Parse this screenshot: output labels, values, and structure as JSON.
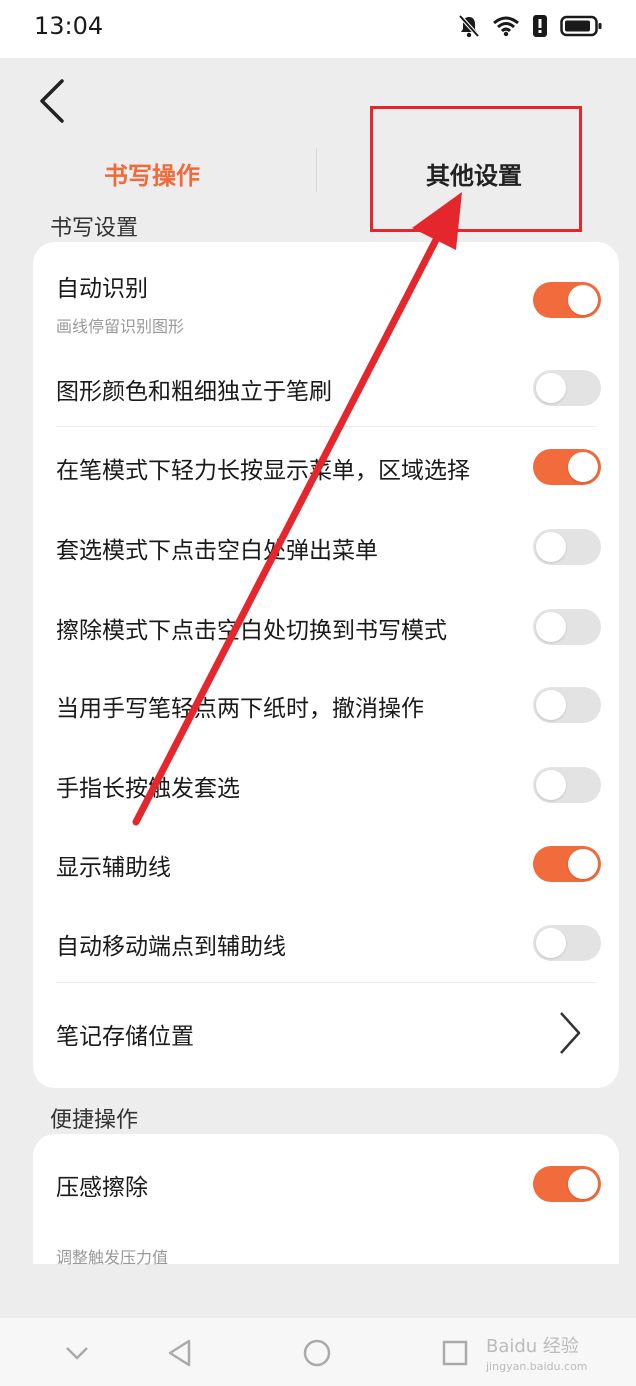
{
  "status_bar": {
    "time": "13:04",
    "icons": [
      "bell-mute-icon",
      "wifi-icon",
      "alert-icon",
      "battery-icon"
    ]
  },
  "header": {
    "back_icon": "back-chevron-icon",
    "tabs": [
      {
        "label": "书写操作",
        "active": true
      },
      {
        "label": "其他设置",
        "active": false
      }
    ]
  },
  "writing_settings": {
    "title": "书写设置",
    "items": [
      {
        "label": "自动识别",
        "sublabel": "画线停留识别图形",
        "control": "toggle",
        "on": true
      },
      {
        "label": "图形颜色和粗细独立于笔刷",
        "control": "toggle",
        "on": false
      },
      {
        "label": "在笔模式下轻力长按显示菜单，区域选择",
        "control": "toggle",
        "on": true
      },
      {
        "label": "套选模式下点击空白处弹出菜单",
        "control": "toggle",
        "on": false
      },
      {
        "label": "擦除模式下点击空白处切换到书写模式",
        "control": "toggle",
        "on": false
      },
      {
        "label": "当用手写笔轻点两下纸时，撤消操作",
        "control": "toggle",
        "on": false
      },
      {
        "label": "手指长按触发套选",
        "control": "toggle",
        "on": false
      },
      {
        "label": "显示辅助线",
        "control": "toggle",
        "on": true
      },
      {
        "label": "自动移动端点到辅助线",
        "control": "toggle",
        "on": false
      },
      {
        "label": "笔记存储位置",
        "control": "chevron"
      }
    ]
  },
  "quick_actions": {
    "title": "便捷操作",
    "items": [
      {
        "label": "压感擦除",
        "control": "toggle",
        "on": true
      },
      {
        "label": "调整触发压力值"
      }
    ]
  },
  "nav_bar": {
    "buttons": [
      "collapse-icon",
      "back-triangle-icon",
      "home-circle-icon",
      "recents-square-icon"
    ],
    "watermark_main": "Baidu 经验",
    "watermark_sub": "jingyan.baidu.com"
  },
  "colors": {
    "accent": "#f26b3c",
    "annotation_red": "#e5262d"
  }
}
